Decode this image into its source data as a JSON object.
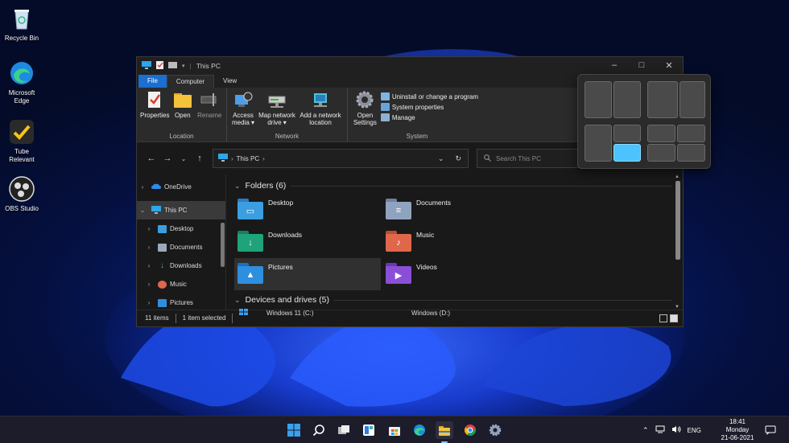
{
  "desktop": {
    "icons": [
      {
        "label": "Recycle Bin",
        "icon": "recycle-bin-icon"
      },
      {
        "label": "Microsoft Edge",
        "icon": "edge-icon"
      },
      {
        "label": "Tube Relevant",
        "icon": "tube-relevant-icon"
      },
      {
        "label": "OBS Studio",
        "icon": "obs-icon"
      }
    ]
  },
  "window": {
    "title": "This PC",
    "controls": {
      "minimize": "–",
      "maximize": "□",
      "close": "✕"
    }
  },
  "ribbon": {
    "tabs": [
      {
        "label": "File"
      },
      {
        "label": "Computer"
      },
      {
        "label": "View"
      }
    ],
    "groups": {
      "location": {
        "label": "Location",
        "buttons": [
          {
            "label": "Properties"
          },
          {
            "label": "Open"
          },
          {
            "label": "Rename"
          }
        ]
      },
      "network": {
        "label": "Network",
        "buttons": [
          {
            "label": "Access media ▾"
          },
          {
            "label": "Map network drive ▾"
          },
          {
            "label": "Add a network location"
          }
        ]
      },
      "system": {
        "label": "System",
        "open_settings": "Open Settings",
        "commands": [
          {
            "label": "Uninstall or change a program"
          },
          {
            "label": "System properties"
          },
          {
            "label": "Manage"
          }
        ]
      }
    }
  },
  "address": {
    "path": "This PC",
    "search_placeholder": "Search This PC"
  },
  "nav_pane": {
    "items": [
      {
        "label": "OneDrive",
        "selected": false,
        "indent": 0,
        "expanded": false
      },
      {
        "label": "This PC",
        "selected": true,
        "indent": 0,
        "expanded": true
      },
      {
        "label": "Desktop",
        "selected": false,
        "indent": 1,
        "expanded": false
      },
      {
        "label": "Documents",
        "selected": false,
        "indent": 1,
        "expanded": false
      },
      {
        "label": "Downloads",
        "selected": false,
        "indent": 1,
        "expanded": false
      },
      {
        "label": "Music",
        "selected": false,
        "indent": 1,
        "expanded": false
      },
      {
        "label": "Pictures",
        "selected": false,
        "indent": 1,
        "expanded": false
      }
    ]
  },
  "content": {
    "folders_header": "Folders (6)",
    "folders": [
      {
        "name": "Desktop",
        "color": "#3a9ee0",
        "selected": false
      },
      {
        "name": "Documents",
        "color": "#8fa3bf",
        "selected": false
      },
      {
        "name": "Downloads",
        "color": "#1fa37a",
        "selected": false
      },
      {
        "name": "Music",
        "color": "#e0674a",
        "selected": false
      },
      {
        "name": "Pictures",
        "color": "#2e8fe0",
        "selected": true
      },
      {
        "name": "Videos",
        "color": "#8a4fd6",
        "selected": false
      }
    ],
    "devices_header": "Devices and drives (5)",
    "drives": [
      {
        "name": "Windows 11 (C:)"
      },
      {
        "name": "Windows (D:)"
      }
    ]
  },
  "status": {
    "items": "11 items",
    "selected": "1 item selected"
  },
  "taskbar": {
    "apps": [
      "start-icon",
      "search-icon",
      "task-view-icon",
      "widgets-icon",
      "store-icon",
      "edge-icon",
      "file-explorer-icon",
      "chrome-icon",
      "settings-icon"
    ],
    "active_app": "file-explorer-icon",
    "language": "ENG",
    "time": "18:41",
    "day": "Monday",
    "date": "21-06-2021"
  },
  "colors": {
    "accent": "#4cc2ff",
    "file_tab": "#1a6fd0"
  }
}
